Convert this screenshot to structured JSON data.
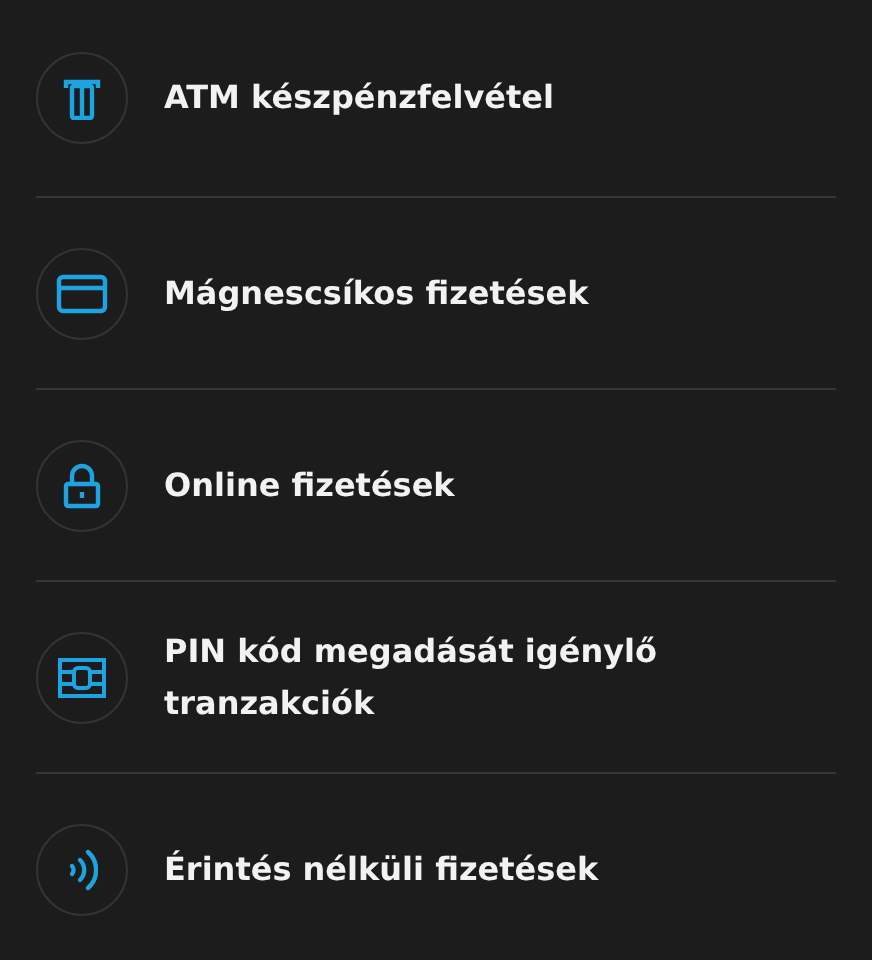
{
  "items": [
    {
      "label": "ATM készpénzfelvétel"
    },
    {
      "label": "Mágnescsíkos fizetések"
    },
    {
      "label": "Online fizetések"
    },
    {
      "label": "PIN kód megadását igénylő tranzakciók"
    },
    {
      "label": "Érintés nélküli fizetések"
    }
  ]
}
